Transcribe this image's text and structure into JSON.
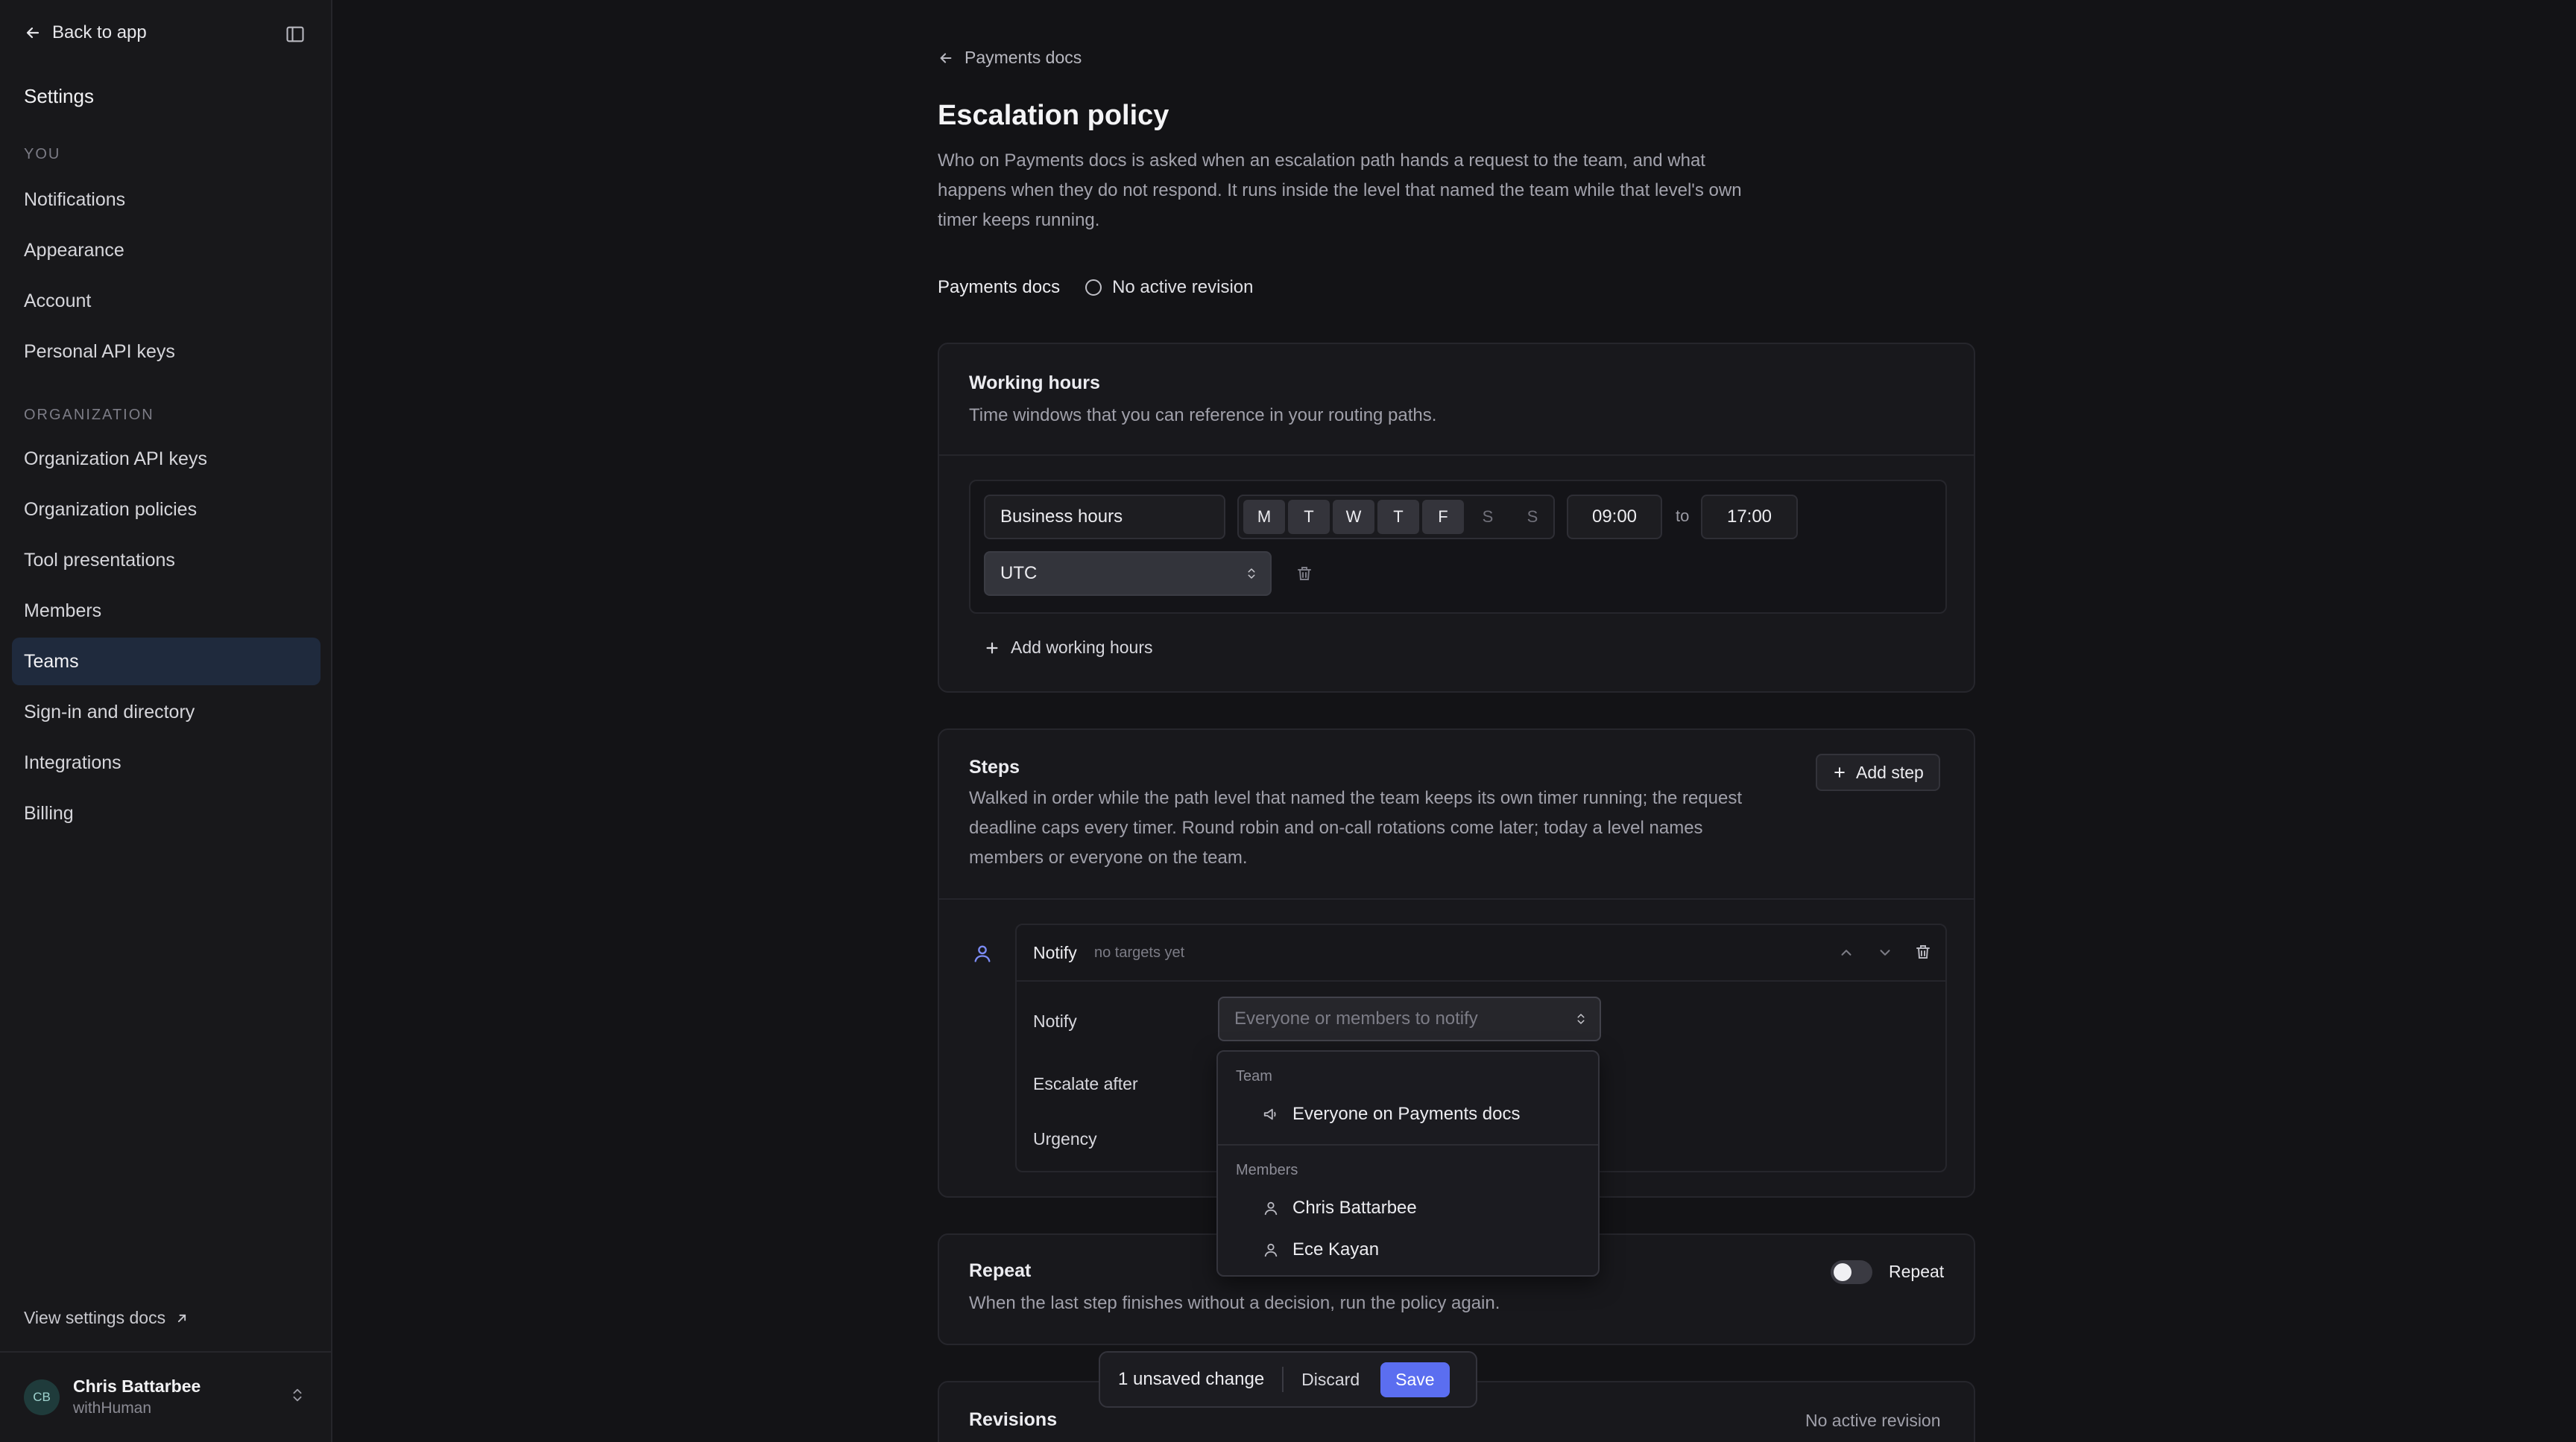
{
  "sidebar": {
    "back_label": "Back to app",
    "settings_title": "Settings",
    "section_you": "YOU",
    "you_items": [
      {
        "label": "Notifications"
      },
      {
        "label": "Appearance"
      },
      {
        "label": "Account"
      },
      {
        "label": "Personal API keys"
      }
    ],
    "section_org": "ORGANIZATION",
    "org_items": [
      {
        "label": "Organization API keys"
      },
      {
        "label": "Organization policies"
      },
      {
        "label": "Tool presentations"
      },
      {
        "label": "Members"
      },
      {
        "label": "Teams",
        "active": true
      },
      {
        "label": "Sign-in and directory"
      },
      {
        "label": "Integrations"
      },
      {
        "label": "Billing"
      }
    ],
    "docs_link": "View settings docs",
    "user": {
      "initials": "CB",
      "name": "Chris Battarbee",
      "org": "withHuman"
    }
  },
  "main": {
    "breadcrumb": "Payments docs",
    "title": "Escalation policy",
    "description": "Who on Payments docs is asked when an escalation path hands a request to the team, and what happens when they do not respond. It runs inside the level that named the team while that level's own timer keeps running.",
    "team_name": "Payments docs",
    "revision_status": "No active revision",
    "working_hours": {
      "title": "Working hours",
      "description": "Time windows that you can reference in your routing paths.",
      "entry_name": "Business hours",
      "days": [
        {
          "label": "M",
          "on": true
        },
        {
          "label": "T",
          "on": true
        },
        {
          "label": "W",
          "on": true
        },
        {
          "label": "T",
          "on": true
        },
        {
          "label": "F",
          "on": true
        },
        {
          "label": "S",
          "on": false
        },
        {
          "label": "S",
          "on": false
        }
      ],
      "start": "09:00",
      "to_label": "to",
      "end": "17:00",
      "timezone": "UTC",
      "add_label": "Add working hours"
    },
    "steps": {
      "title": "Steps",
      "description": "Walked in order while the path level that named the team keeps its own timer running; the request deadline caps every timer. Round robin and on-call rotations come later; today a level names members or everyone on the team.",
      "add_label": "Add step",
      "step": {
        "type": "Notify",
        "hint": "no targets yet",
        "notify_label": "Notify",
        "notify_placeholder": "Everyone or members to notify",
        "escalate_label": "Escalate after",
        "urgency_label": "Urgency"
      }
    },
    "dropdown": {
      "team_section": "Team",
      "team_option": "Everyone on Payments docs",
      "members_section": "Members",
      "members": [
        "Chris Battarbee",
        "Ece Kayan"
      ]
    },
    "repeat": {
      "title": "Repeat",
      "description": "When the last step finishes without a decision, run the policy again.",
      "toggle_label": "Repeat",
      "enabled": false
    },
    "revisions": {
      "title": "Revisions",
      "status": "No active revision"
    }
  },
  "savebar": {
    "count": "1 unsaved change",
    "discard": "Discard",
    "save": "Save"
  },
  "colors": {
    "accent": "#5b6ef0",
    "active_nav": "#1f2a3d",
    "background": "#131316"
  }
}
